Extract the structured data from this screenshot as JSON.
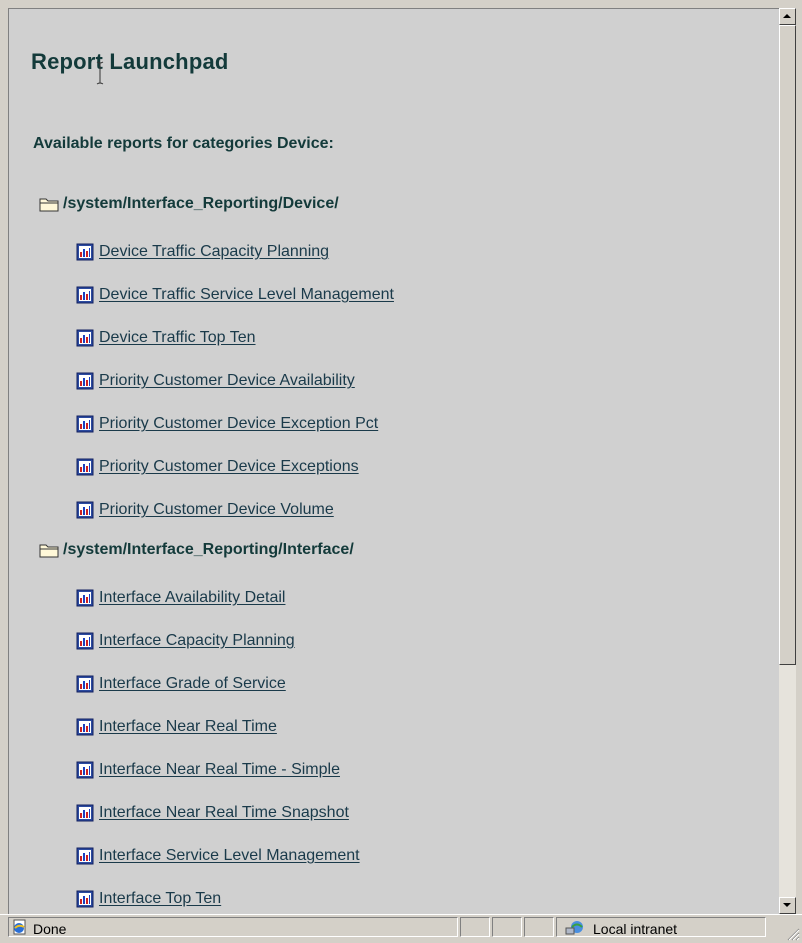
{
  "page": {
    "title": "Report Launchpad",
    "subheading": "Available reports for categories Device:"
  },
  "folders": [
    {
      "path": "/system/Interface_Reporting/Device/",
      "reports": [
        "Device Traffic Capacity Planning",
        "Device Traffic Service Level Management",
        "Device Traffic Top Ten",
        "Priority Customer Device Availability",
        "Priority Customer Device Exception Pct",
        "Priority Customer Device Exceptions",
        "Priority Customer Device Volume"
      ]
    },
    {
      "path": "/system/Interface_Reporting/Interface/",
      "reports": [
        "Interface Availability Detail",
        "Interface Capacity Planning",
        "Interface Grade of Service",
        "Interface Near Real Time",
        "Interface Near Real Time - Simple",
        "Interface Near Real Time Snapshot",
        "Interface Service Level Management",
        "Interface Top Ten"
      ]
    }
  ],
  "status": {
    "text": "Done",
    "zone": "Local intranet"
  },
  "colors": {
    "heading": "#133a3a",
    "link": "#1a3a4a",
    "background": "#d0d0d0"
  },
  "icons": {
    "folder": "folder-icon",
    "report": "report-chart-icon",
    "page": "ie-page-icon",
    "zone": "intranet-globe-icon"
  }
}
